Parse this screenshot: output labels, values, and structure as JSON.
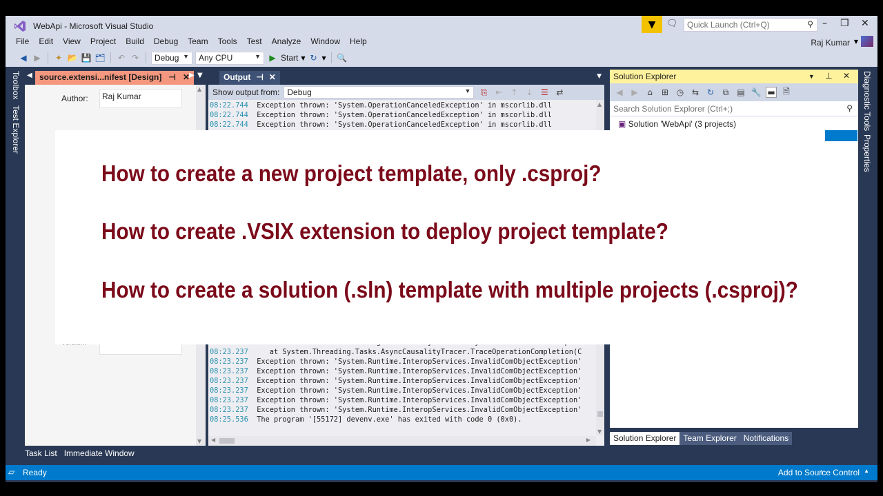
{
  "window": {
    "title": "WebApi - Microsoft Visual Studio",
    "user_name": "Raj Kumar",
    "quick_launch_placeholder": "Quick Launch (Ctrl+Q)"
  },
  "menu": [
    "File",
    "Edit",
    "View",
    "Project",
    "Build",
    "Debug",
    "Team",
    "Tools",
    "Test",
    "Analyze",
    "Window",
    "Help"
  ],
  "toolbar": {
    "config": "Debug",
    "platform": "Any CPU",
    "start_label": "Start"
  },
  "left_vertical_tabs": [
    "Toolbox",
    "Test Explorer"
  ],
  "right_vertical_tabs": [
    "Diagnostic Tools",
    "Properties"
  ],
  "doc_pane": {
    "tab_title": "source.extensi...nifest [Design]",
    "fields": [
      {
        "label": "Author:",
        "value": "Raj Kumar"
      },
      {
        "label": "Version:",
        "value": ""
      }
    ]
  },
  "output_pane": {
    "tab_title": "Output",
    "show_output_from_label": "Show output from:",
    "source": "Debug",
    "lines_top": [
      {
        "ts": "08:22.744",
        "msg": "Exception thrown: 'System.OperationCanceledException' in mscorlib.dll"
      },
      {
        "ts": "08:22.744",
        "msg": "Exception thrown: 'System.OperationCanceledException' in mscorlib.dll"
      },
      {
        "ts": "08:22.744",
        "msg": "Exception thrown: 'System.OperationCanceledException' in mscorlib.dll"
      }
    ],
    "lines_bottom": [
      {
        "ts": "08:23.237",
        "msg": "   at Windows.Foundation.Diagnostics.IAsyncCausalityTracerStatics.TraceOpera"
      },
      {
        "ts": "08:23.237",
        "msg": "   at System.Threading.Tasks.AsyncCausalityTracer.TraceOperationCompletion(C"
      },
      {
        "ts": "08:23.237",
        "msg": "Exception thrown: 'System.Runtime.InteropServices.InvalidComObjectException'"
      },
      {
        "ts": "08:23.237",
        "msg": "Exception thrown: 'System.Runtime.InteropServices.InvalidComObjectException'"
      },
      {
        "ts": "08:23.237",
        "msg": "Exception thrown: 'System.Runtime.InteropServices.InvalidComObjectException'"
      },
      {
        "ts": "08:23.237",
        "msg": "Exception thrown: 'System.Runtime.InteropServices.InvalidComObjectException'"
      },
      {
        "ts": "08:23.237",
        "msg": "Exception thrown: 'System.Runtime.InteropServices.InvalidComObjectException'"
      },
      {
        "ts": "08:23.237",
        "msg": "Exception thrown: 'System.Runtime.InteropServices.InvalidComObjectException'"
      },
      {
        "ts": "08:25.536",
        "msg": "The program '[55172] devenv.exe' has exited with code 0 (0x0)."
      }
    ]
  },
  "solution_explorer": {
    "title": "Solution Explorer",
    "search_placeholder": "Search Solution Explorer (Ctrl+;)",
    "root_item": "Solution 'WebApi' (3 projects)",
    "tabs": [
      "Solution Explorer",
      "Team Explorer",
      "Notifications"
    ]
  },
  "bottom_tabs": [
    "Task List",
    "Immediate Window"
  ],
  "status": {
    "left": "Ready",
    "right": "Add to Source Control"
  },
  "overlay": {
    "questions": [
      "How to create a new project template, only .csproj?",
      "How to create .VSIX extension to deploy project template?",
      "How to create a solution (.sln) template with multiple projects (.csproj)?"
    ],
    "text_color": "#7b0a1a"
  },
  "colors": {
    "accent": "#007acc",
    "doc_tab": "#f5977f",
    "sol_header": "#fff29d",
    "frame": "#293955"
  }
}
